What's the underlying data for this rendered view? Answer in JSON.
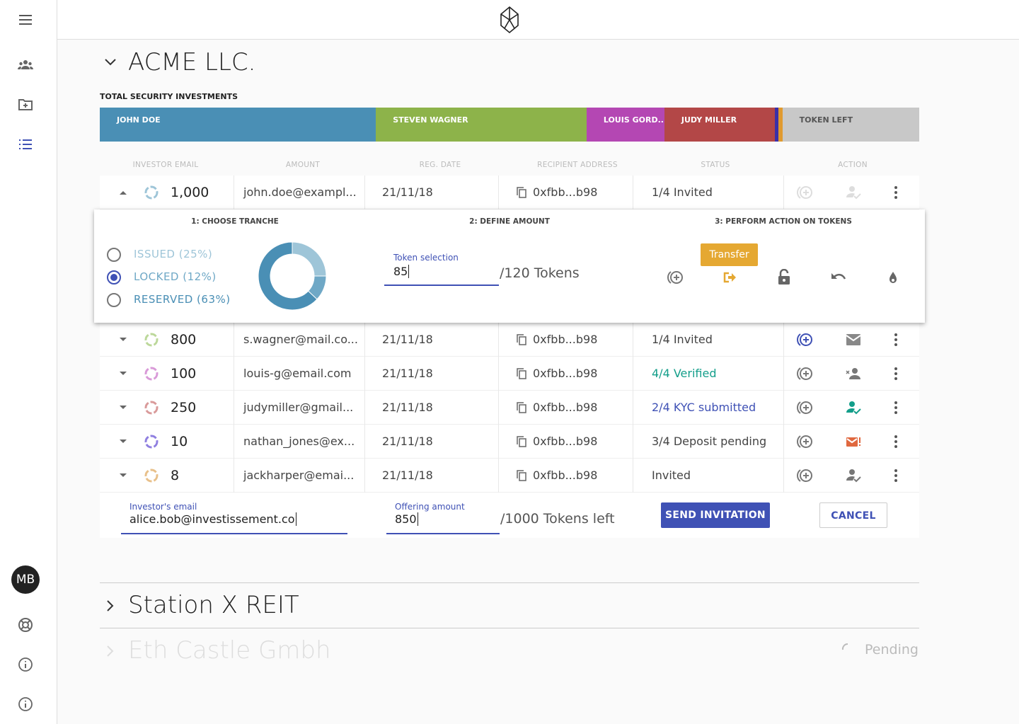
{
  "sidebar": {
    "items": [
      "menu-icon",
      "investors-icon",
      "add-folder-icon",
      "list-icon"
    ],
    "avatar": "MB",
    "bottom": [
      "help-icon",
      "info-icon",
      "info-icon"
    ],
    "active_color": "#3f51b5"
  },
  "header": {
    "logo": "logo-icon"
  },
  "section1": {
    "title": "ACME LLC.",
    "subtitle": "TOTAL SECURITY INVESTMENTS"
  },
  "investment_bar": [
    {
      "label": "JOHN DOE",
      "color": "#4a8fb5",
      "share": 33.7
    },
    {
      "label": "STEVEN WAGNER",
      "color": "#8db34a",
      "share": 25.7
    },
    {
      "label": "LOUIS GORD...",
      "color": "#b447b3",
      "share": 9.5
    },
    {
      "label": "JUDY MILLER",
      "color": "#b34747",
      "share": 13.5
    },
    {
      "label": "",
      "color": "#3a2fa8",
      "share": 0.4
    },
    {
      "label": "",
      "color": "#e09a2f",
      "share": 0.5
    },
    {
      "label": "TOKEN LEFT",
      "color": "#c8c8c8",
      "share": 16.7
    }
  ],
  "table": {
    "headers": [
      "INVESTOR EMAIL",
      "AMOUNT",
      "REG. DATE",
      "RECIPIENT ADDRESS",
      "STATUS",
      "ACTION"
    ],
    "rows": [
      {
        "amount": "1,000",
        "email": "john.doe@exampl...",
        "date": "21/11/18",
        "address": "0xfbb...b98",
        "status": "1/4 Invited",
        "status_color": "#444",
        "ring": "#9ec5d8",
        "expanded": true,
        "add_color": "#ddd",
        "user_icon": "user-check-icon",
        "user_color": "#ddd"
      },
      {
        "amount": "800",
        "email": "s.wagner@mail.co...",
        "date": "21/11/18",
        "address": "0xfbb...b98",
        "status": "1/4 Invited",
        "status_color": "#444",
        "ring": "#bcd89a",
        "add_color": "#3f51b5",
        "user_icon": "mail-icon",
        "user_color": "#888"
      },
      {
        "amount": "100",
        "email": "louis-g@email.com",
        "date": "21/11/18",
        "address": "0xfbb...b98",
        "status": "4/4 Verified",
        "status_color": "#139e8a",
        "ring": "#d99ad8",
        "add_color": "#777",
        "user_icon": "user-remove-icon",
        "user_color": "#777"
      },
      {
        "amount": "250",
        "email": "judymiller@gmail...",
        "date": "21/11/18",
        "address": "0xfbb...b98",
        "status": "2/4 KYC submitted",
        "status_color": "#3f51b5",
        "ring": "#d99a9a",
        "add_color": "#777",
        "user_icon": "user-check-icon",
        "user_color": "#139e8a"
      },
      {
        "amount": "10",
        "email": "nathan_jones@ex...",
        "date": "21/11/18",
        "address": "0xfbb...b98",
        "status": "3/4 Deposit pending",
        "status_color": "#444",
        "ring": "#8f7fe0",
        "add_color": "#777",
        "user_icon": "mail-alert-icon",
        "user_color": "#e0683f"
      },
      {
        "amount": "8",
        "email": "jackharper@emai...",
        "date": "21/11/18",
        "address": "0xfbb...b98",
        "status": "Invited",
        "status_color": "#444",
        "ring": "#e8c08a",
        "add_color": "#777",
        "user_icon": "user-check-icon",
        "user_color": "#777"
      }
    ]
  },
  "panel": {
    "steps": [
      "1: CHOOSE TRANCHE",
      "2: DEFINE AMOUNT",
      "3: PERFORM ACTION ON TOKENS"
    ],
    "tranches": [
      {
        "label": "ISSUED (25%)",
        "pct": 25,
        "color": "#9ec5d8",
        "selected": false
      },
      {
        "label": "LOCKED (12%)",
        "pct": 12,
        "color": "#6fa8c6",
        "selected": true
      },
      {
        "label": "RESERVED (63%)",
        "pct": 63,
        "color": "#4a8fb5",
        "selected": false
      }
    ],
    "token_label": "Token selection",
    "token_value": "85",
    "token_suffix": "/120 Tokens",
    "tooltip": "Transfer",
    "actions": [
      "issue-icon",
      "transfer-icon",
      "lock-icon",
      "undo-icon",
      "burn-icon"
    ]
  },
  "invite": {
    "email_label": "Investor's email",
    "email_value": "alice.bob@investissement.co",
    "amount_label": "Offering amount",
    "amount_value": "850",
    "amount_suffix": "/1000 Tokens left",
    "send": "SEND INVITATION",
    "cancel": "CANCEL"
  },
  "section2": {
    "title": "Station X  REIT"
  },
  "section3": {
    "title": "Eth Castle Gmbh",
    "status": "Pending"
  }
}
